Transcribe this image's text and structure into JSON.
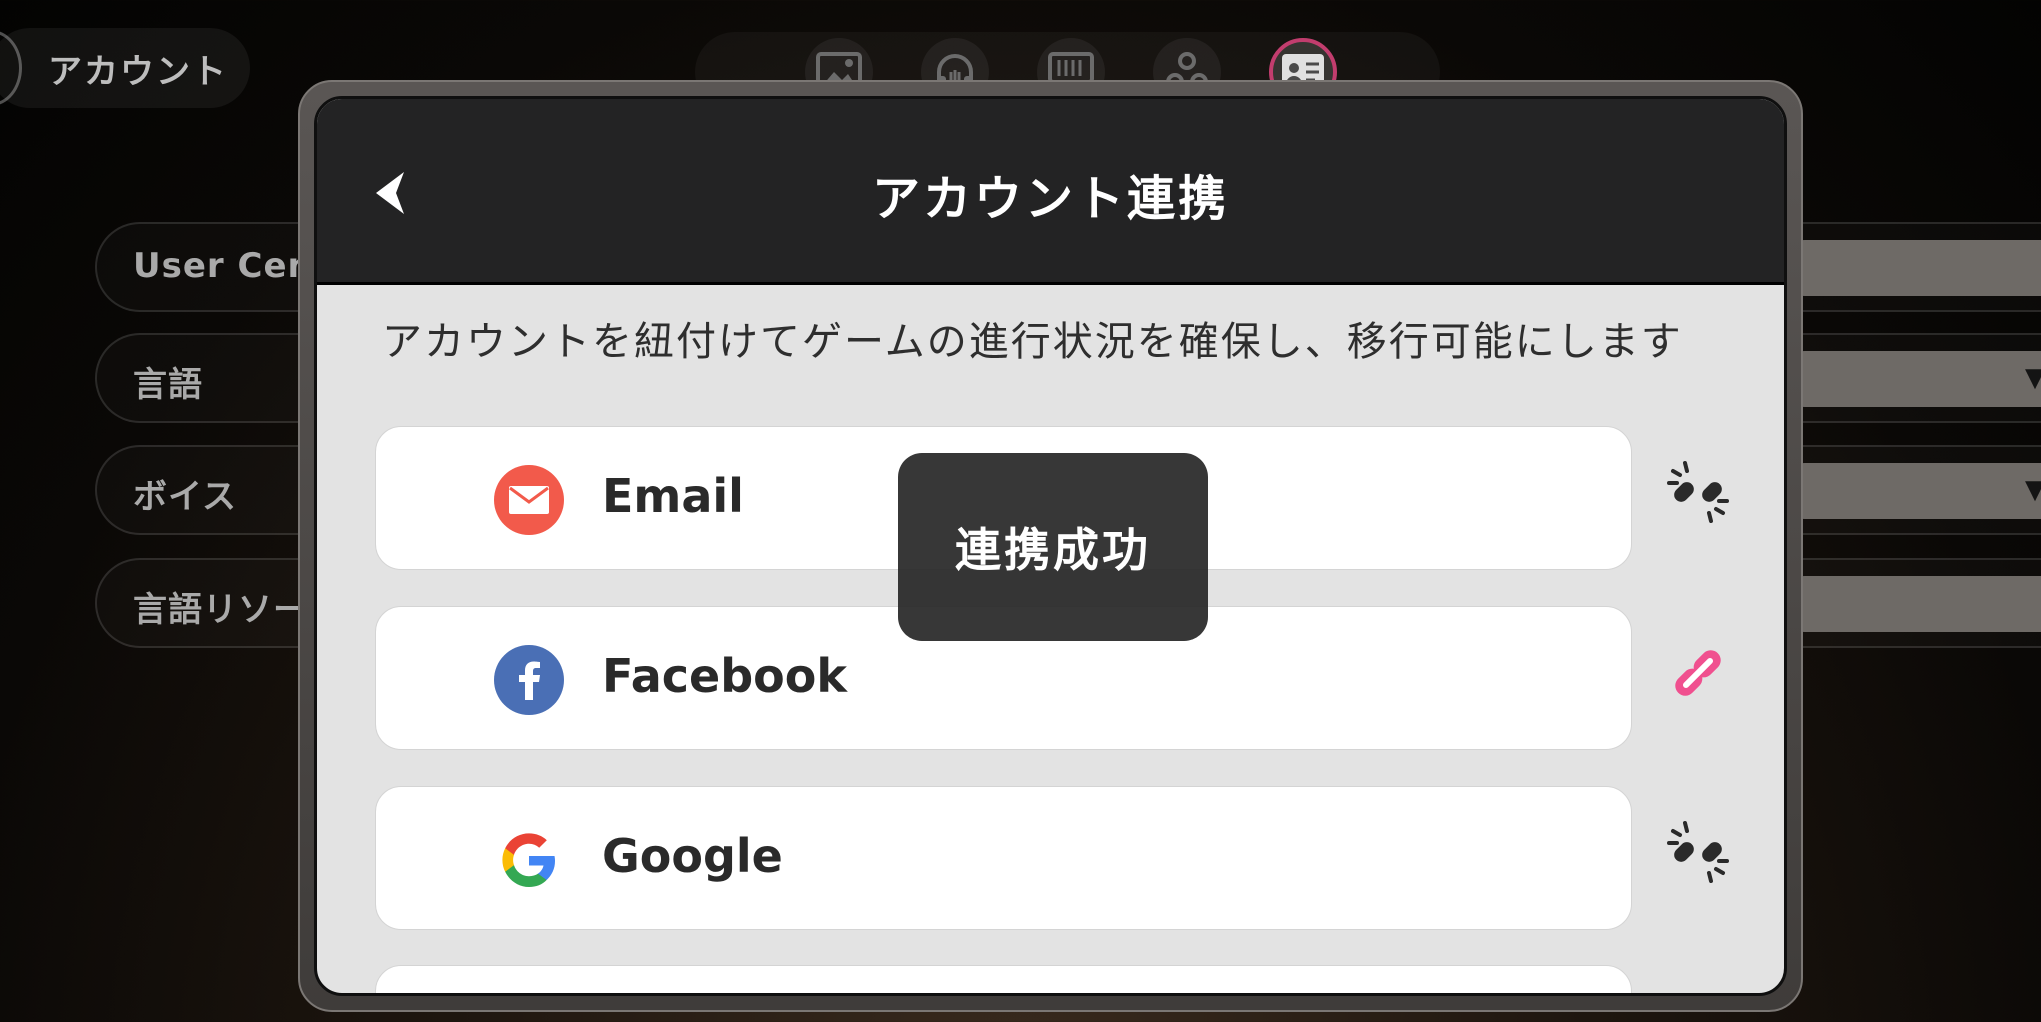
{
  "background": {
    "page_title": "アカウント",
    "tabs": [
      {
        "icon": "image-icon",
        "active": false
      },
      {
        "icon": "headphones-icon",
        "active": false
      },
      {
        "icon": "display-icon",
        "active": false
      },
      {
        "icon": "circles-icon",
        "active": false
      },
      {
        "icon": "profile-card-icon",
        "active": true
      }
    ],
    "settings": [
      {
        "label": "User Cente",
        "control": "button"
      },
      {
        "label": "言語",
        "control": "dropdown"
      },
      {
        "label": "ボイス",
        "control": "dropdown"
      },
      {
        "label": "言語リソース",
        "control": "button"
      }
    ]
  },
  "modal": {
    "title": "アカウント連携",
    "description": "アカウントを紐付けてゲームの進行状況を確保し、移行可能にします",
    "accounts": [
      {
        "name": "Email",
        "icon": "email-icon",
        "brand_color": "#f25a4b",
        "link_state": "unlinked",
        "link_icon": "broken-link-icon"
      },
      {
        "name": "Facebook",
        "icon": "facebook-icon",
        "brand_color": "#4a6fb5",
        "link_state": "linked",
        "link_icon": "link-icon"
      },
      {
        "name": "Google",
        "icon": "google-icon",
        "brand_color": "#4285f4",
        "link_state": "unlinked",
        "link_icon": "broken-link-icon"
      }
    ]
  },
  "toast": {
    "message": "連携成功"
  },
  "colors": {
    "accent_pink": "#f0508f",
    "modal_header": "#232324",
    "unlinked_icon": "#2a2a2a"
  }
}
